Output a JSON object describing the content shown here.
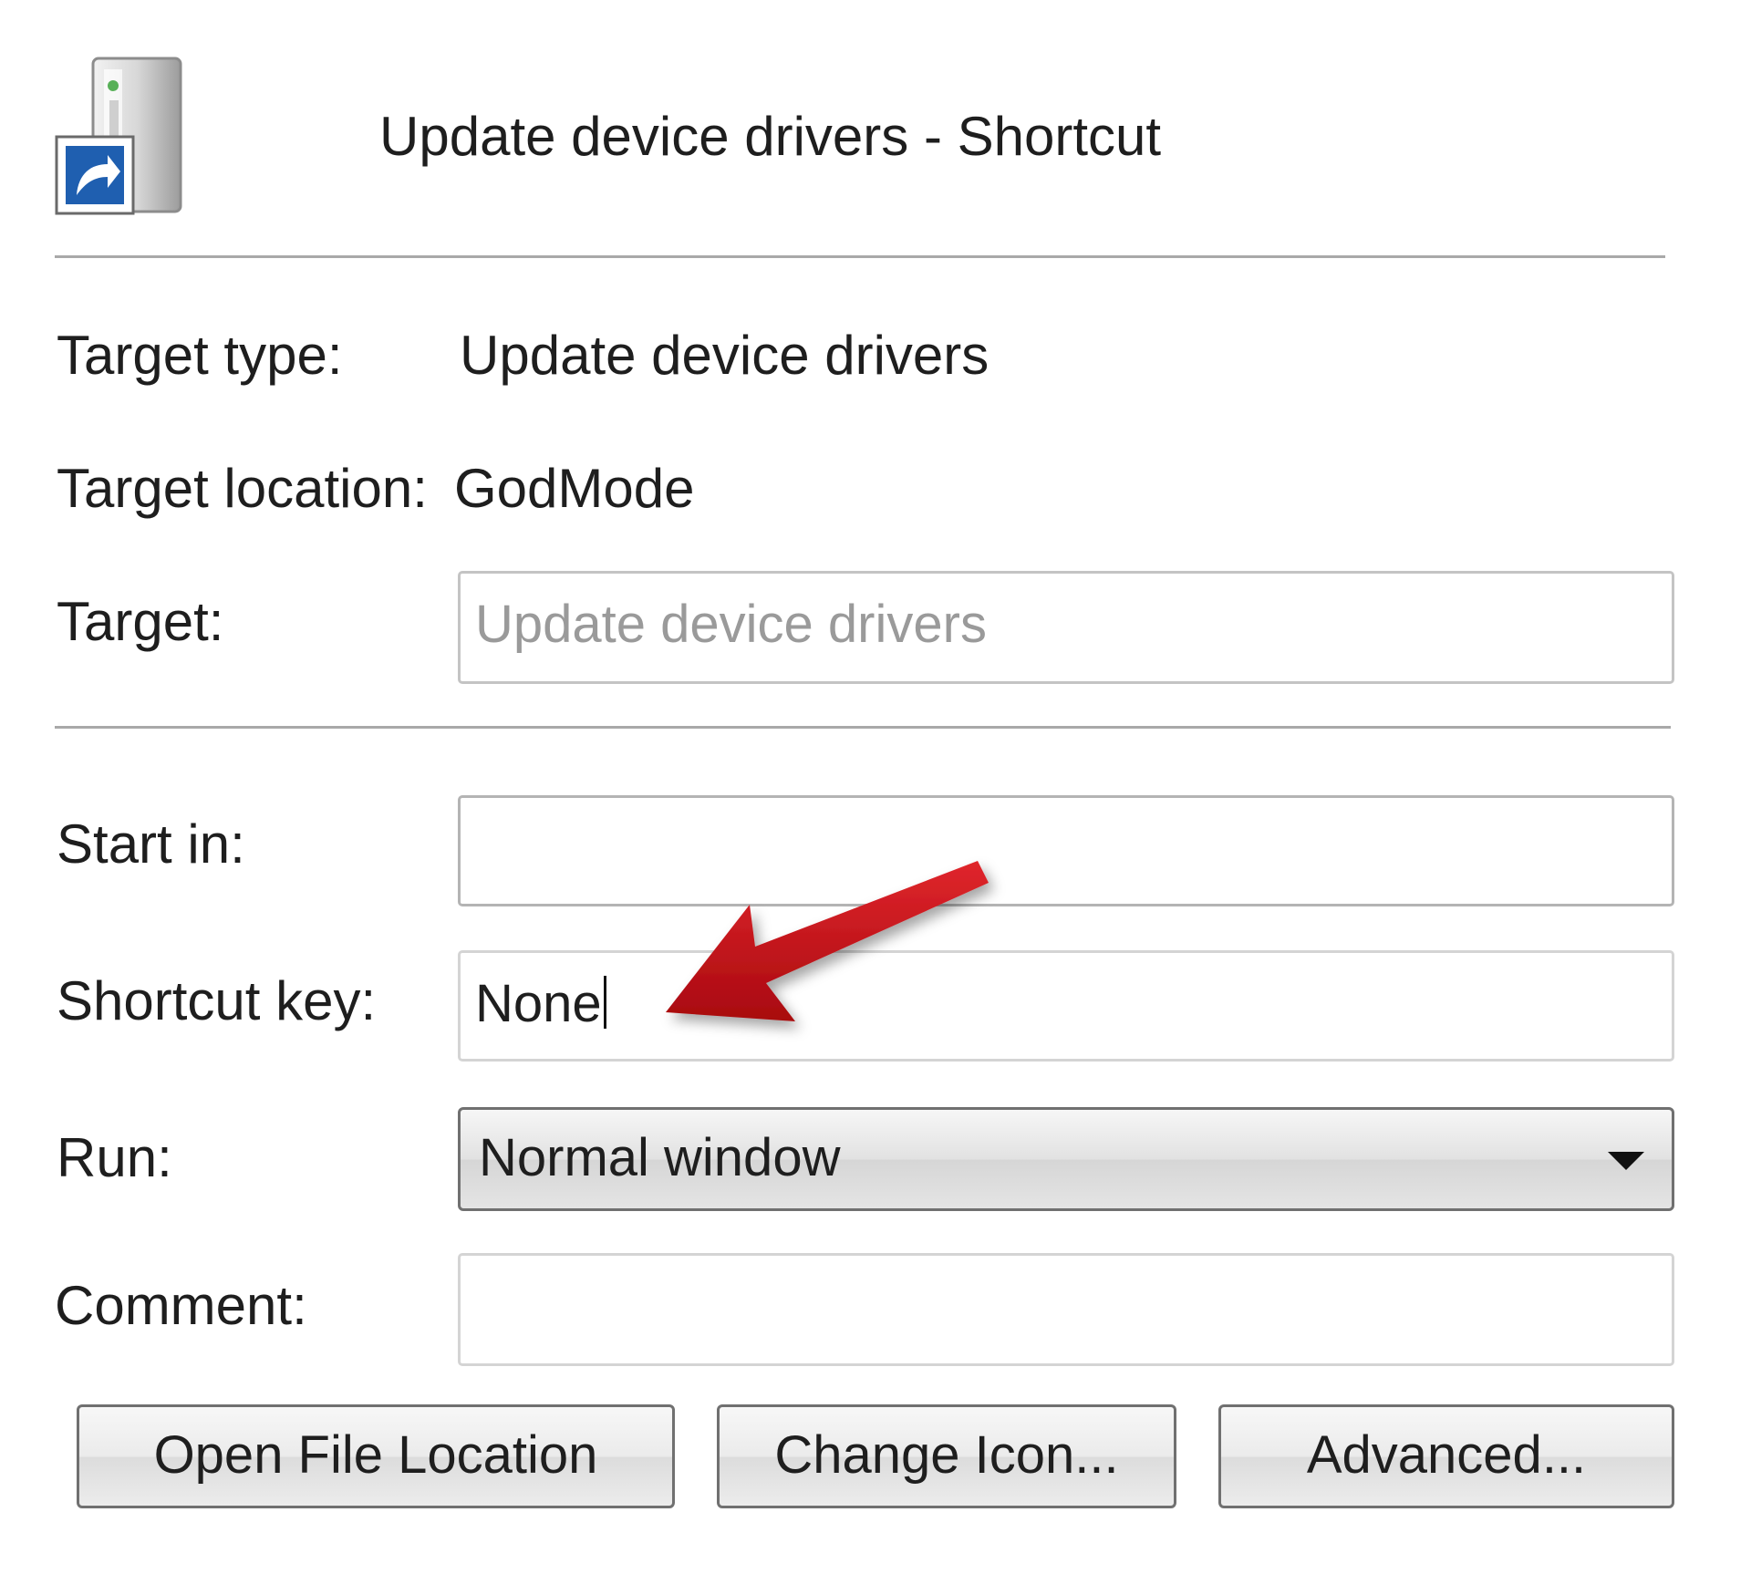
{
  "header": {
    "title": "Update device drivers - Shortcut",
    "icon": "shortcut-app-icon"
  },
  "target_section": {
    "target_type_label": "Target type:",
    "target_type_value": "Update device drivers",
    "target_location_label": "Target location:",
    "target_location_value": "GodMode",
    "target_label": "Target:",
    "target_value": "Update device drivers"
  },
  "options_section": {
    "start_in_label": "Start in:",
    "start_in_value": "",
    "shortcut_key_label": "Shortcut key:",
    "shortcut_key_value": "None",
    "run_label": "Run:",
    "run_selected": "Normal window",
    "comment_label": "Comment:",
    "comment_value": ""
  },
  "buttons": {
    "open_file_location": "Open File Location",
    "change_icon": "Change Icon...",
    "advanced": "Advanced..."
  },
  "annotation": {
    "arrow_color": "#c0151b",
    "icon": "red-arrow-icon"
  }
}
